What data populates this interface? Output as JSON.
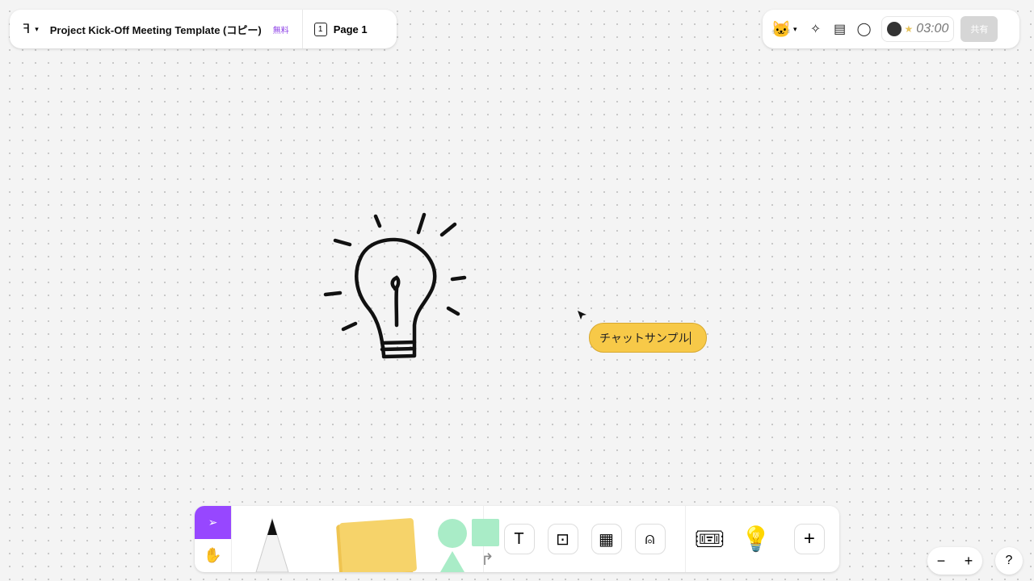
{
  "header": {
    "file_title": "Project Kick-Off Meeting Template (コピー)",
    "plan_badge": "無料",
    "page_label": "Page 1",
    "page_number": "1"
  },
  "topright": {
    "timer": "03:00",
    "share_label": "共有"
  },
  "canvas": {
    "chat_text": "チャットサンプル"
  },
  "zoom": {
    "minus": "−",
    "plus": "+",
    "help": "?"
  }
}
